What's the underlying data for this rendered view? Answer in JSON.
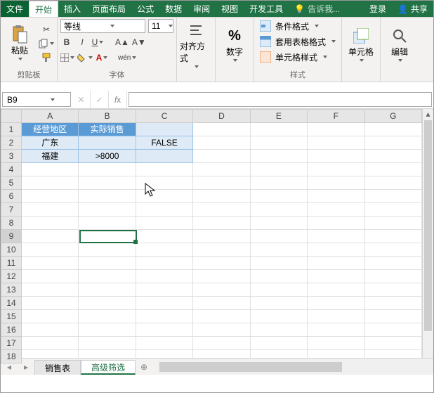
{
  "tabs": {
    "file": "文件",
    "home": "开始",
    "insert": "插入",
    "layout": "页面布局",
    "formulas": "公式",
    "data": "数据",
    "review": "审阅",
    "view": "视图",
    "dev": "开发工具",
    "tell": "告诉我...",
    "login": "登录",
    "share": "共享"
  },
  "ribbon": {
    "clipboard": {
      "paste": "粘贴",
      "label": "剪贴板"
    },
    "font": {
      "name": "等线",
      "size": "11",
      "label": "字体",
      "phonetic": "wén"
    },
    "align": {
      "label": "对齐方式"
    },
    "number": {
      "label": "数字"
    },
    "styles": {
      "cond": "条件格式",
      "table": "套用表格格式",
      "cell": "单元格样式",
      "label": "样式"
    },
    "cells": {
      "label": "单元格"
    },
    "editing": {
      "label": "编辑"
    }
  },
  "namebox": "B9",
  "columns": [
    "A",
    "B",
    "C",
    "D",
    "E",
    "F",
    "G"
  ],
  "rows": [
    "1",
    "2",
    "3",
    "4",
    "5",
    "6",
    "7",
    "8",
    "9",
    "10",
    "11",
    "12",
    "13",
    "14",
    "15",
    "16",
    "17",
    "18"
  ],
  "cells": {
    "A1": "经营地区",
    "B1": "实际销售",
    "A2": "广东",
    "C2": "FALSE",
    "A3": "福建",
    "B3": ">8000"
  },
  "sheets": {
    "s1": "销售表",
    "s2": "高级筛选"
  },
  "active": {
    "row": 9,
    "col": "B"
  }
}
